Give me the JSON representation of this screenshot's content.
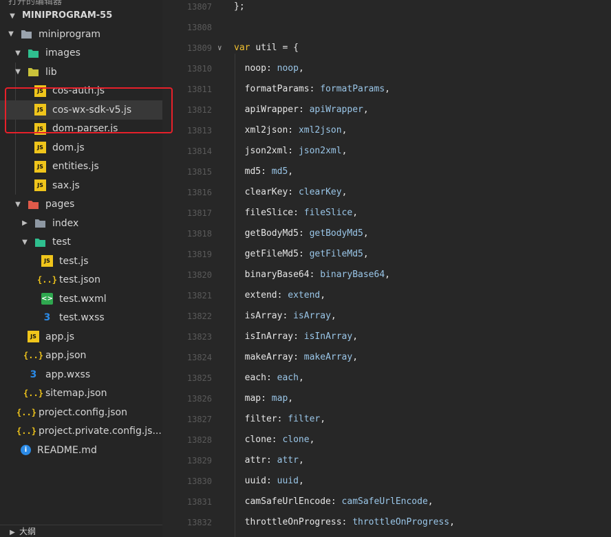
{
  "sidebar": {
    "top_partial": "打开的编辑器",
    "section_title": "MINIPROGRAM-55",
    "tree": [
      {
        "label": "miniprogram",
        "icon": "folder-open-icon",
        "depth": 0,
        "chevron": "down",
        "type": "folder"
      },
      {
        "label": "images",
        "icon": "images-folder-icon",
        "depth": 1,
        "chevron": "down",
        "type": "folder"
      },
      {
        "label": "lib",
        "icon": "lib-folder-icon",
        "depth": 1,
        "chevron": "down",
        "type": "folder"
      },
      {
        "label": "cos-auth.js",
        "icon": "js-file-icon",
        "depth": 2,
        "chevron": "none",
        "type": "js"
      },
      {
        "label": "cos-wx-sdk-v5.js",
        "icon": "js-file-icon",
        "depth": 2,
        "chevron": "none",
        "type": "js",
        "selected": true
      },
      {
        "label": "dom-parser.js",
        "icon": "js-file-icon",
        "depth": 2,
        "chevron": "none",
        "type": "js"
      },
      {
        "label": "dom.js",
        "icon": "js-file-icon",
        "depth": 2,
        "chevron": "none",
        "type": "js"
      },
      {
        "label": "entities.js",
        "icon": "js-file-icon",
        "depth": 2,
        "chevron": "none",
        "type": "js"
      },
      {
        "label": "sax.js",
        "icon": "js-file-icon",
        "depth": 2,
        "chevron": "none",
        "type": "js"
      },
      {
        "label": "pages",
        "icon": "pages-folder-icon",
        "depth": 1,
        "chevron": "down",
        "type": "folder"
      },
      {
        "label": "index",
        "icon": "folder-icon",
        "depth": 2,
        "chevron": "right",
        "type": "folder"
      },
      {
        "label": "test",
        "icon": "test-folder-icon",
        "depth": 2,
        "chevron": "down",
        "type": "folder"
      },
      {
        "label": "test.js",
        "icon": "js-file-icon",
        "depth": 3,
        "chevron": "none",
        "type": "js"
      },
      {
        "label": "test.json",
        "icon": "json-file-icon",
        "depth": 3,
        "chevron": "none",
        "type": "json"
      },
      {
        "label": "test.wxml",
        "icon": "wxml-file-icon",
        "depth": 3,
        "chevron": "none",
        "type": "wxml"
      },
      {
        "label": "test.wxss",
        "icon": "wxss-file-icon",
        "depth": 3,
        "chevron": "none",
        "type": "wxss"
      },
      {
        "label": "app.js",
        "icon": "js-file-icon",
        "depth": 1,
        "chevron": "none",
        "type": "js"
      },
      {
        "label": "app.json",
        "icon": "json-file-icon",
        "depth": 1,
        "chevron": "none",
        "type": "json"
      },
      {
        "label": "app.wxss",
        "icon": "wxss-file-icon",
        "depth": 1,
        "chevron": "none",
        "type": "wxss"
      },
      {
        "label": "sitemap.json",
        "icon": "json-file-icon",
        "depth": 1,
        "chevron": "none",
        "type": "json"
      },
      {
        "label": "project.config.json",
        "icon": "json-file-icon",
        "depth": 0,
        "chevron": "none",
        "type": "json"
      },
      {
        "label": "project.private.config.js...",
        "icon": "json-file-icon",
        "depth": 0,
        "chevron": "none",
        "type": "json"
      },
      {
        "label": "README.md",
        "icon": "info-icon",
        "depth": 0,
        "chevron": "none",
        "type": "info"
      }
    ],
    "outline_label": "大纲"
  },
  "icons": {
    "js_text": "JS",
    "json_text": "{..}",
    "wxml_text": "<>",
    "wxss_text": "3",
    "info_text": "i"
  },
  "colors": {
    "annotation": "#e8202a",
    "keyword": "#f0c030",
    "property_value": "#9ac6e8",
    "js_icon": "#f0c51b"
  },
  "editor": {
    "lines": [
      {
        "num": "13807",
        "kind": "plain",
        "text": "};"
      },
      {
        "num": "13808",
        "kind": "empty",
        "text": ""
      },
      {
        "num": "13809",
        "kind": "decl",
        "keyword": "var",
        "name": "util",
        "rest": " = {",
        "fold": true
      },
      {
        "num": "13810",
        "kind": "prop",
        "key": "noop",
        "val": "noop"
      },
      {
        "num": "13811",
        "kind": "prop",
        "key": "formatParams",
        "val": "formatParams"
      },
      {
        "num": "13812",
        "kind": "prop",
        "key": "apiWrapper",
        "val": "apiWrapper"
      },
      {
        "num": "13813",
        "kind": "prop",
        "key": "xml2json",
        "val": "xml2json"
      },
      {
        "num": "13814",
        "kind": "prop",
        "key": "json2xml",
        "val": "json2xml"
      },
      {
        "num": "13815",
        "kind": "prop",
        "key": "md5",
        "val": "md5"
      },
      {
        "num": "13816",
        "kind": "prop",
        "key": "clearKey",
        "val": "clearKey"
      },
      {
        "num": "13817",
        "kind": "prop",
        "key": "fileSlice",
        "val": "fileSlice"
      },
      {
        "num": "13818",
        "kind": "prop",
        "key": "getBodyMd5",
        "val": "getBodyMd5"
      },
      {
        "num": "13819",
        "kind": "prop",
        "key": "getFileMd5",
        "val": "getFileMd5"
      },
      {
        "num": "13820",
        "kind": "prop",
        "key": "binaryBase64",
        "val": "binaryBase64"
      },
      {
        "num": "13821",
        "kind": "prop",
        "key": "extend",
        "val": "extend"
      },
      {
        "num": "13822",
        "kind": "prop",
        "key": "isArray",
        "val": "isArray"
      },
      {
        "num": "13823",
        "kind": "prop",
        "key": "isInArray",
        "val": "isInArray"
      },
      {
        "num": "13824",
        "kind": "prop",
        "key": "makeArray",
        "val": "makeArray"
      },
      {
        "num": "13825",
        "kind": "prop",
        "key": "each",
        "val": "each"
      },
      {
        "num": "13826",
        "kind": "prop",
        "key": "map",
        "val": "map"
      },
      {
        "num": "13827",
        "kind": "prop",
        "key": "filter",
        "val": "filter"
      },
      {
        "num": "13828",
        "kind": "prop",
        "key": "clone",
        "val": "clone"
      },
      {
        "num": "13829",
        "kind": "prop",
        "key": "attr",
        "val": "attr"
      },
      {
        "num": "13830",
        "kind": "prop",
        "key": "uuid",
        "val": "uuid"
      },
      {
        "num": "13831",
        "kind": "prop",
        "key": "camSafeUrlEncode",
        "val": "camSafeUrlEncode"
      },
      {
        "num": "13832",
        "kind": "prop",
        "key": "throttleOnProgress",
        "val": "throttleOnProgress"
      }
    ]
  }
}
